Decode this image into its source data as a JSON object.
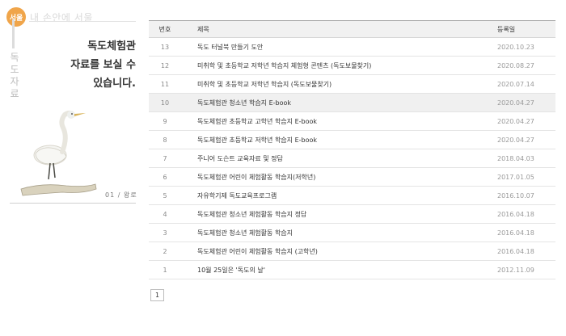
{
  "site": {
    "logo_mark": "서울",
    "logo_text": "내 손안에 서울"
  },
  "sidebar": {
    "vertical_label": [
      "독",
      "도",
      "자",
      "료"
    ],
    "headline": [
      "독도체험관",
      "자료를 보실 수",
      "있습니다."
    ],
    "counter": "01 / 왕로"
  },
  "table": {
    "headers": {
      "num": "번호",
      "title": "제목",
      "date": "등록일"
    },
    "rows": [
      {
        "num": "13",
        "title": "독도 터널북 만들기 도안",
        "date": "2020.10.23"
      },
      {
        "num": "12",
        "title": "미취학 및 초등학교 저학년 학습지 체험형 콘텐츠 (독도보물찾기)",
        "date": "2020.08.27"
      },
      {
        "num": "11",
        "title": "미취학 및 초등학교 저학년 학습지 (독도보물찾기)",
        "date": "2020.07.14"
      },
      {
        "num": "10",
        "title": "독도체험관 청소년 학습지 E-book",
        "date": "2020.04.27"
      },
      {
        "num": "9",
        "title": "독도체험관 초등학교 고학년 학습지 E-book",
        "date": "2020.04.27"
      },
      {
        "num": "8",
        "title": "독도체험관 초등학교 저학년 학습지 E-book",
        "date": "2020.04.27"
      },
      {
        "num": "7",
        "title": "주니어 도슨트 교육자료 및 정답",
        "date": "2018.04.03"
      },
      {
        "num": "6",
        "title": "독도체험관 어린이 체험활동 학습지(저학년)",
        "date": "2017.01.05"
      },
      {
        "num": "5",
        "title": "자유학기제 독도교육프로그램",
        "date": "2016.10.07"
      },
      {
        "num": "4",
        "title": "독도체험관 청소년 체험활동 학습지 정답",
        "date": "2016.04.18"
      },
      {
        "num": "3",
        "title": "독도체험관 청소년 체험활동 학습지",
        "date": "2016.04.18"
      },
      {
        "num": "2",
        "title": "독도체험관 어린이 체험활동 학습지 (고학년)",
        "date": "2016.04.18"
      },
      {
        "num": "1",
        "title": "10월 25일은 '독도의 날'",
        "date": "2012.11.09"
      }
    ]
  },
  "pagination": {
    "current": "1"
  }
}
